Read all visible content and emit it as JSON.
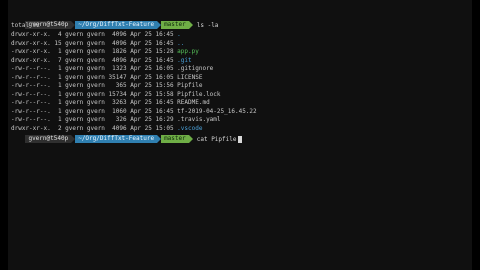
{
  "prompt": {
    "user_host": "gvern@t540p",
    "path": "~/Org/DiffTxt-Feature",
    "branch": "master"
  },
  "cmd1": "ls -la",
  "total": "total 92",
  "listing": [
    {
      "perm": "drwxr-xr-x.",
      "links": " 4",
      "owner": "gvern",
      "group": "gvern",
      "size": "4096",
      "month": "Apr",
      "day": "25",
      "time": "16:45",
      "name": ".",
      "type": "dir"
    },
    {
      "perm": "drwxr-xr-x.",
      "links": "15",
      "owner": "gvern",
      "group": "gvern",
      "size": "4096",
      "month": "Apr",
      "day": "25",
      "time": "16:45",
      "name": "..",
      "type": "dir"
    },
    {
      "perm": "-rwxr-xr-x.",
      "links": " 1",
      "owner": "gvern",
      "group": "gvern",
      "size": "1826",
      "month": "Apr",
      "day": "25",
      "time": "15:28",
      "name": "app.py",
      "type": "exe"
    },
    {
      "perm": "drwxr-xr-x.",
      "links": " 7",
      "owner": "gvern",
      "group": "gvern",
      "size": "4096",
      "month": "Apr",
      "day": "25",
      "time": "16:45",
      "name": ".git",
      "type": "dir"
    },
    {
      "perm": "-rw-r--r--.",
      "links": " 1",
      "owner": "gvern",
      "group": "gvern",
      "size": "1323",
      "month": "Apr",
      "day": "25",
      "time": "16:05",
      "name": ".gitignore",
      "type": "file"
    },
    {
      "perm": "-rw-r--r--.",
      "links": " 1",
      "owner": "gvern",
      "group": "gvern",
      "size": "35147",
      "month": "Apr",
      "day": "25",
      "time": "16:05",
      "name": "LICENSE",
      "type": "file"
    },
    {
      "perm": "-rw-r--r--.",
      "links": " 1",
      "owner": "gvern",
      "group": "gvern",
      "size": "365",
      "month": "Apr",
      "day": "25",
      "time": "15:56",
      "name": "Pipfile",
      "type": "file"
    },
    {
      "perm": "-rw-r--r--.",
      "links": " 1",
      "owner": "gvern",
      "group": "gvern",
      "size": "15734",
      "month": "Apr",
      "day": "25",
      "time": "15:58",
      "name": "Pipfile.lock",
      "type": "file"
    },
    {
      "perm": "-rw-r--r--.",
      "links": " 1",
      "owner": "gvern",
      "group": "gvern",
      "size": "3263",
      "month": "Apr",
      "day": "25",
      "time": "16:45",
      "name": "README.md",
      "type": "file"
    },
    {
      "perm": "-rw-r--r--.",
      "links": " 1",
      "owner": "gvern",
      "group": "gvern",
      "size": "1060",
      "month": "Apr",
      "day": "25",
      "time": "16:45",
      "name": "tf-2019-04-25_16.45.22",
      "type": "file"
    },
    {
      "perm": "-rw-r--r--.",
      "links": " 1",
      "owner": "gvern",
      "group": "gvern",
      "size": "326",
      "month": "Apr",
      "day": "25",
      "time": "16:29",
      "name": ".travis.yaml",
      "type": "file"
    },
    {
      "perm": "drwxr-xr-x.",
      "links": " 2",
      "owner": "gvern",
      "group": "gvern",
      "size": "4096",
      "month": "Apr",
      "day": "25",
      "time": "15:05",
      "name": ".vscode",
      "type": "dir"
    }
  ],
  "cmd2": "cat Pipfile"
}
